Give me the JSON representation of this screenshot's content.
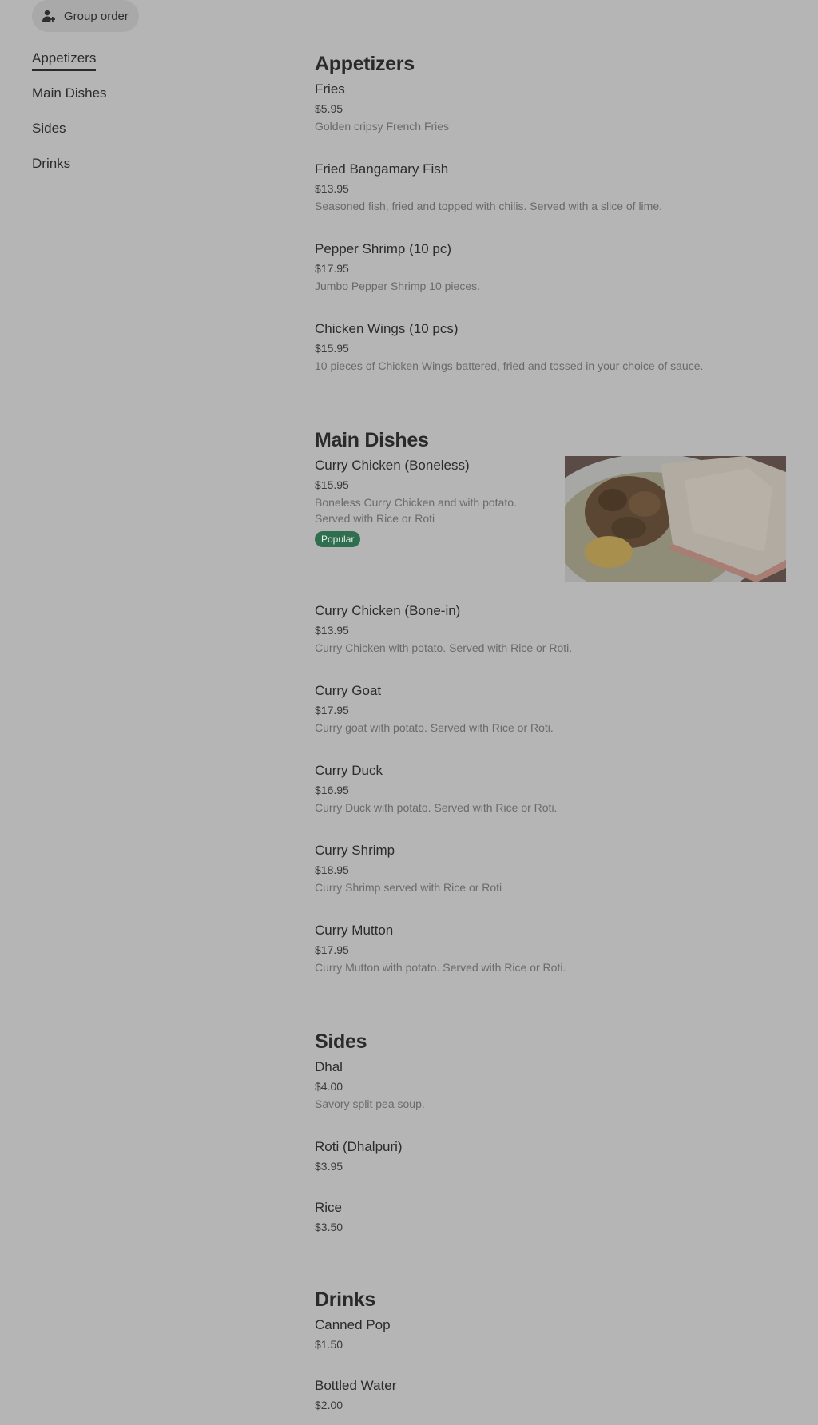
{
  "toolbar": {
    "group_order_label": "Group order",
    "group_order_icon": "group-add-icon"
  },
  "sidebar": {
    "items": [
      {
        "label": "Appetizers",
        "active": true
      },
      {
        "label": "Main Dishes"
      },
      {
        "label": "Sides"
      },
      {
        "label": "Drinks"
      }
    ]
  },
  "sections": {
    "appetizers": {
      "title": "Appetizers",
      "items": [
        {
          "name": "Fries",
          "price": "$5.95",
          "description": "Golden cripsy French Fries"
        },
        {
          "name": "Fried Bangamary Fish",
          "price": "$13.95",
          "description": "Seasoned fish, fried and topped with chilis. Served with a slice of lime."
        },
        {
          "name": "Pepper Shrimp (10 pc)",
          "price": "$17.95",
          "description": "Jumbo Pepper Shrimp 10 pieces."
        },
        {
          "name": "Chicken Wings (10 pcs)",
          "price": "$15.95",
          "description": "10 pieces of Chicken Wings battered, fried and tossed in your choice of sauce."
        }
      ]
    },
    "main_dishes": {
      "title": "Main Dishes",
      "items": [
        {
          "name": "Curry Chicken (Boneless)",
          "price": "$15.95",
          "description": "Boneless Curry Chicken and with potato. Served with Rice or Roti",
          "badge": "Popular"
        },
        {
          "name": "Curry Chicken (Bone-in)",
          "price": "$13.95",
          "description": "Curry Chicken with potato. Served with Rice or Roti."
        },
        {
          "name": "Curry Goat",
          "price": "$17.95",
          "description": "Curry goat with potato. Served with Rice or Roti."
        },
        {
          "name": "Curry Duck",
          "price": "$16.95",
          "description": "Curry Duck with potato. Served with Rice or Roti."
        },
        {
          "name": "Curry Shrimp",
          "price": "$18.95",
          "description": "Curry Shrimp served with Rice or Roti"
        },
        {
          "name": "Curry Mutton",
          "price": "$17.95",
          "description": "Curry Mutton with potato. Served with Rice or Roti."
        }
      ]
    },
    "sides": {
      "title": "Sides",
      "items": [
        {
          "name": "Dhal",
          "price": "$4.00",
          "description": "Savory split pea soup."
        },
        {
          "name": "Roti (Dhalpuri)",
          "price": "$3.95"
        },
        {
          "name": "Rice",
          "price": "$3.50"
        }
      ]
    },
    "drinks": {
      "title": "Drinks",
      "items": [
        {
          "name": "Canned Pop",
          "price": "$1.50"
        },
        {
          "name": "Bottled Water",
          "price": "$2.00"
        }
      ]
    }
  }
}
